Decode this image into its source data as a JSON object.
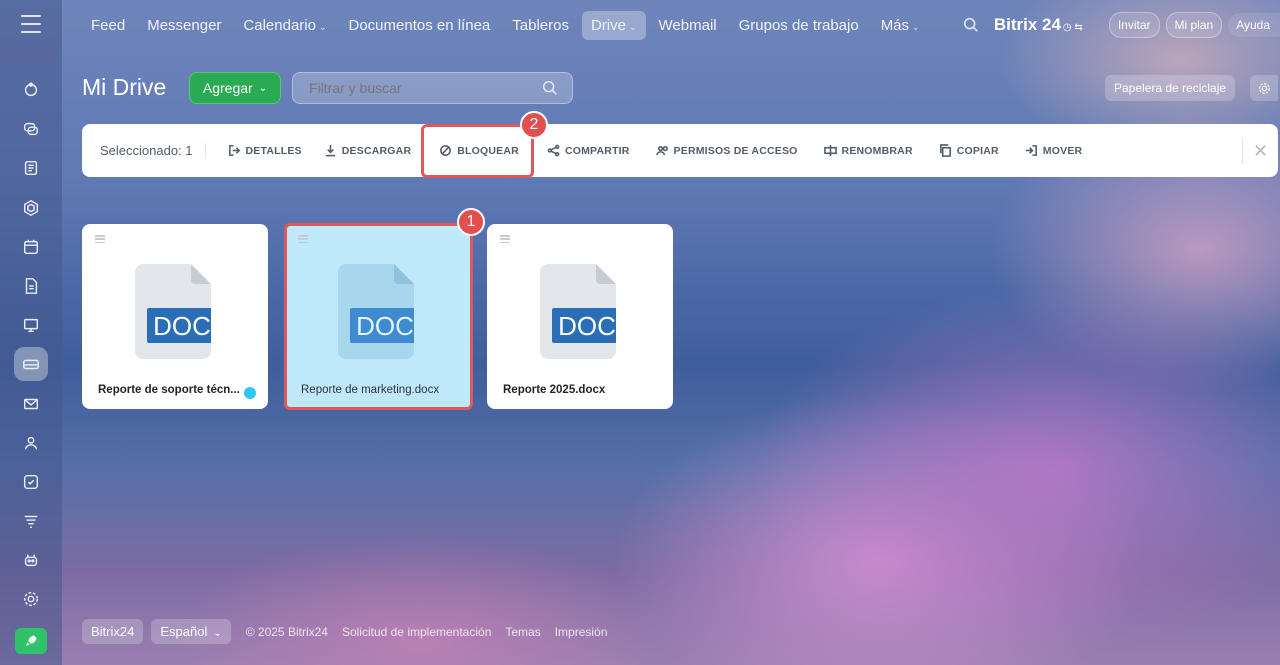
{
  "topbar": {
    "nav": [
      {
        "label": "Feed",
        "caret": false
      },
      {
        "label": "Messenger",
        "caret": false
      },
      {
        "label": "Calendario",
        "caret": true
      },
      {
        "label": "Documentos en línea",
        "caret": false
      },
      {
        "label": "Tableros",
        "caret": false
      },
      {
        "label": "Drive",
        "caret": true,
        "active": true
      },
      {
        "label": "Webmail",
        "caret": false
      },
      {
        "label": "Grupos de trabajo",
        "caret": false
      },
      {
        "label": "Más",
        "caret": true
      }
    ],
    "brand": "Bitrix 24",
    "invite": "Invitar",
    "myplan": "Mi plan",
    "help": "Ayuda"
  },
  "page": {
    "title": "Mi Drive",
    "add_label": "Agregar",
    "filter_placeholder": "Filtrar y buscar",
    "trash_label": "Papelera de reciclaje"
  },
  "toolbar": {
    "selected": "Seleccionado: 1",
    "buttons": [
      {
        "label": "DETALLES",
        "icon": "exit-icon"
      },
      {
        "label": "DESCARGAR",
        "icon": "download-icon"
      },
      {
        "label": "BLOQUEAR",
        "icon": "block-icon"
      },
      {
        "label": "COMPARTIR",
        "icon": "share-icon"
      },
      {
        "label": "PERMISOS DE ACCESO",
        "icon": "users-icon"
      },
      {
        "label": "RENOMBRAR",
        "icon": "rename-icon"
      },
      {
        "label": "COPIAR",
        "icon": "copy-icon"
      },
      {
        "label": "MOVER",
        "icon": "move-icon"
      }
    ]
  },
  "files": [
    {
      "name": "Reporte de soporte técn...",
      "type": "DOC",
      "selected": false,
      "shared": true
    },
    {
      "name": "Reporte de marketing.docx",
      "type": "DOC",
      "selected": true,
      "shared": false
    },
    {
      "name": "Reporte 2025.docx",
      "type": "DOC",
      "selected": false,
      "shared": false
    }
  ],
  "annotations": [
    "1",
    "2"
  ],
  "footer": {
    "brand": "Bitrix24",
    "language": "Español",
    "links": [
      "© 2025 Bitrix24",
      "Solicitud de implementación",
      "Temas",
      "Impresión"
    ]
  },
  "colors": {
    "accent_green": "#2aab53",
    "doc_blue": "#2a6fb5",
    "annotation_red": "#e24f4f",
    "selected_card": "#bfe9fb"
  }
}
